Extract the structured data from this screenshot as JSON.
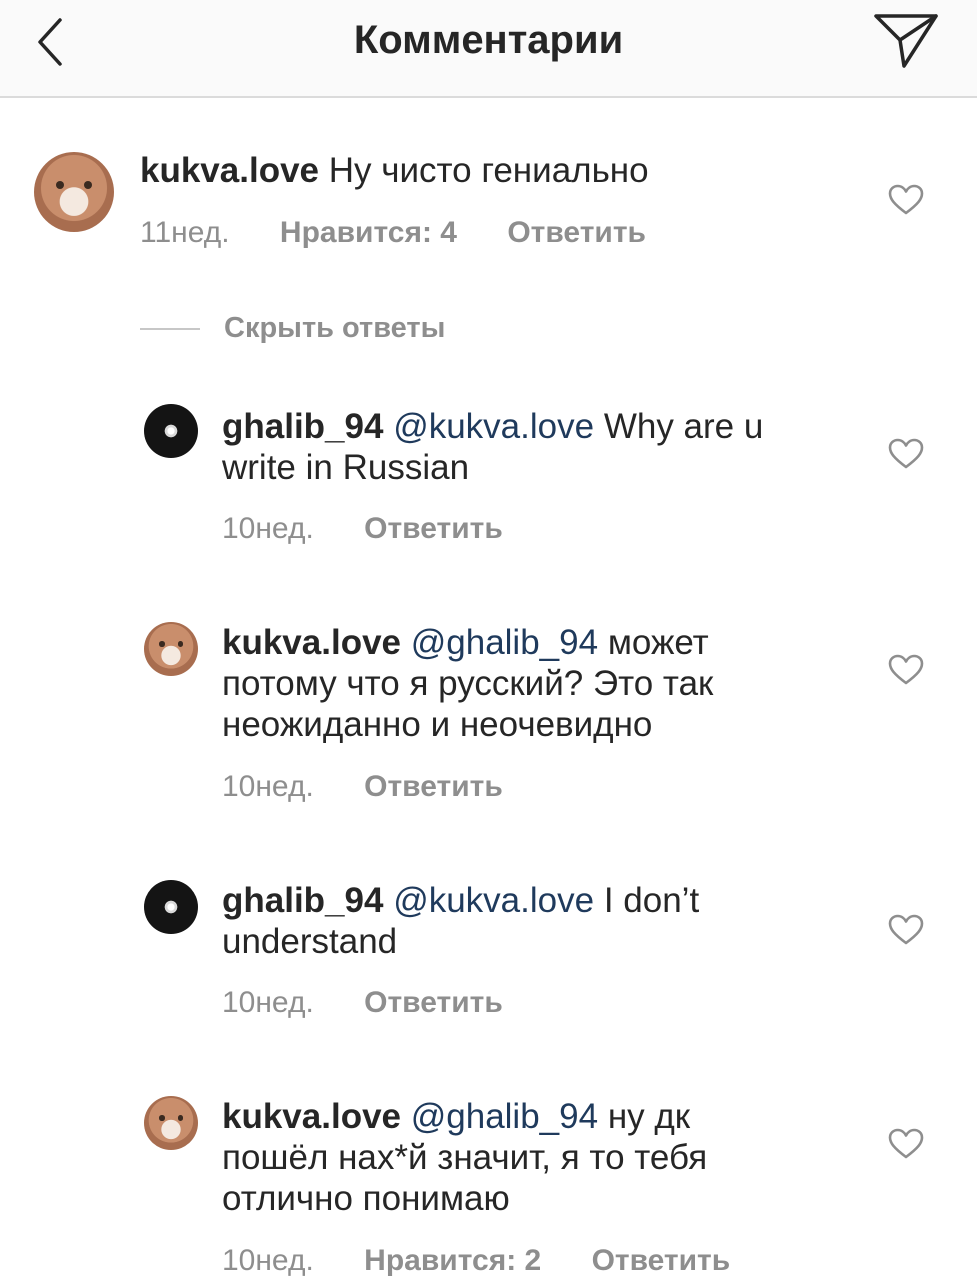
{
  "header": {
    "title": "Комментарии"
  },
  "main_comment": {
    "username": "kukva.love",
    "text": "Ну чисто гениально",
    "time": "11нед.",
    "likes": "Нравится: 4",
    "reply": "Ответить"
  },
  "toggle_replies": "Скрыть ответы",
  "replies": [
    {
      "username": "ghalib_94",
      "mention": "@kukva.love",
      "text": "Why are u write in Russian",
      "time": "10нед.",
      "likes": "",
      "reply": "Ответить"
    },
    {
      "username": "kukva.love",
      "mention": "@ghalib_94",
      "text": "может потому что я русский? Это так неожиданно и неочевидно",
      "time": "10нед.",
      "likes": "",
      "reply": "Ответить"
    },
    {
      "username": "ghalib_94",
      "mention": "@kukva.love",
      "text": "I don’t understand",
      "time": "10нед.",
      "likes": "",
      "reply": "Ответить"
    },
    {
      "username": "kukva.love",
      "mention": "@ghalib_94",
      "text": "ну дк пошёл нах*й значит, я то тебя отлично понимаю",
      "time": "10нед.",
      "likes": "Нравится: 2",
      "reply": "Ответить"
    }
  ],
  "icons": {
    "back": "chevron-left-icon",
    "share": "paper-plane-icon",
    "like": "heart-outline-icon"
  },
  "colors": {
    "mention": "#1f3a5c",
    "meta": "#8e8e8e",
    "divider": "#dbdbdb"
  }
}
